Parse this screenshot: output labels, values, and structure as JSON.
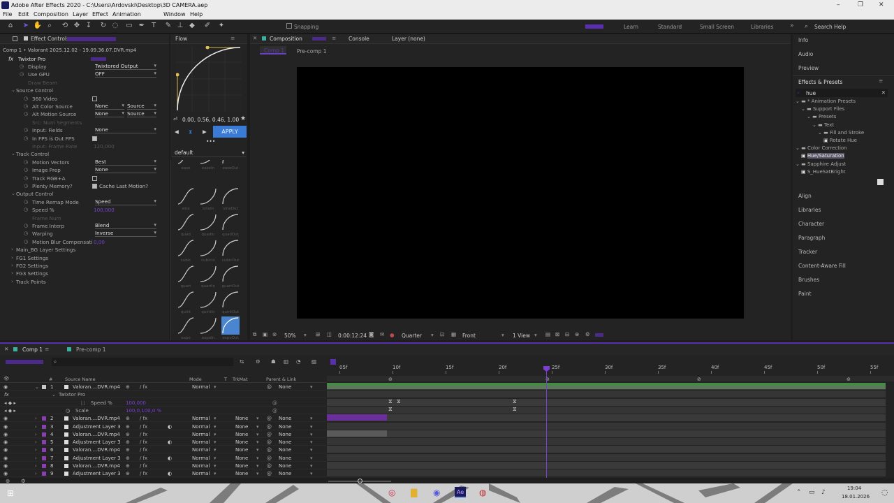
{
  "window": {
    "title": "Adobe After Effects 2020 - C:\\Users\\Ardovski\\Desktop\\3D CAMERA.aep",
    "min": "–",
    "max": "❐",
    "close": "✕"
  },
  "menu": [
    "File",
    "Edit",
    "Composition",
    "Layer",
    "Effect",
    "Animation",
    "Window",
    "Help"
  ],
  "toolbar": {
    "snapping": "Snapping",
    "workspaces": [
      "Learn",
      "Standard",
      "Small Screen",
      "Libraries"
    ],
    "search": "Search Help",
    "more": "»"
  },
  "effect_controls": {
    "tab": "Effect Controls",
    "breadcrumb": "Comp 1 • Valorant 2025.12.02 - 19.09.36.07.DVR.mp4",
    "effect_name": "Twixtor Pro",
    "rows": [
      {
        "label": "Display",
        "value": "Twixtored Output",
        "kind": "dropdown",
        "indent": 2
      },
      {
        "label": "Use GPU",
        "value": "OFF",
        "kind": "dropdown",
        "indent": 2
      },
      {
        "label": "Draw Beam",
        "value": "",
        "kind": "disabled",
        "indent": 2
      },
      {
        "label": "Source Control",
        "value": "",
        "kind": "group",
        "indent": 1
      },
      {
        "label": "360 Video",
        "value": "",
        "kind": "checkbox",
        "indent": 3
      },
      {
        "label": "Alt Color Source",
        "value": "None",
        "value2": "Source",
        "kind": "dual",
        "indent": 3
      },
      {
        "label": "Alt Motion Source",
        "value": "None",
        "value2": "Source",
        "kind": "dual",
        "indent": 3
      },
      {
        "label": "Src: Num Segments",
        "value": "",
        "kind": "disabled",
        "indent": 3
      },
      {
        "label": "Input: Fields",
        "value": "None",
        "kind": "dropdown",
        "indent": 3
      },
      {
        "label": "In FPS is Out FPS",
        "value": "",
        "kind": "checked",
        "indent": 3
      },
      {
        "label": "Input: Frame Rate",
        "value": "120,000",
        "kind": "disabled",
        "indent": 3
      },
      {
        "label": "Track Control",
        "value": "",
        "kind": "group",
        "indent": 1
      },
      {
        "label": "Motion Vectors",
        "value": "Best",
        "kind": "dropdown",
        "indent": 3
      },
      {
        "label": "Image Prep",
        "value": "None",
        "kind": "dropdown",
        "indent": 3
      },
      {
        "label": "Track RGB+A",
        "value": "",
        "kind": "checkbox",
        "indent": 3
      },
      {
        "label": "Plenty Memory?",
        "value": "Cache Last Motion?",
        "kind": "checkedlabel",
        "indent": 3
      },
      {
        "label": "Output Control",
        "value": "",
        "kind": "group",
        "indent": 1
      },
      {
        "label": "Time Remap Mode",
        "value": "Speed",
        "kind": "dropdown",
        "indent": 3
      },
      {
        "label": "Speed %",
        "value": "100,000",
        "kind": "purple",
        "indent": 3
      },
      {
        "label": "Frame Num",
        "value": "",
        "kind": "disabled",
        "indent": 3
      },
      {
        "label": "Frame Interp",
        "value": "Blend",
        "kind": "dropdown",
        "indent": 3
      },
      {
        "label": "Warping",
        "value": "Inverse",
        "kind": "dropdown",
        "indent": 3
      },
      {
        "label": "Motion Blur Compensati",
        "value": "0,00",
        "kind": "purple",
        "indent": 3
      },
      {
        "label": "Main_BG Layer Settings",
        "value": "",
        "kind": "group",
        "indent": 1
      },
      {
        "label": "FG1 Settings",
        "value": "",
        "kind": "group",
        "indent": 1
      },
      {
        "label": "FG2 Settings",
        "value": "",
        "kind": "group",
        "indent": 1
      },
      {
        "label": "FG3 Settings",
        "value": "",
        "kind": "group",
        "indent": 1
      },
      {
        "label": "Track Points",
        "value": "",
        "kind": "group",
        "indent": 1
      }
    ]
  },
  "flow": {
    "tab": "Flow",
    "bezier": "0.00, 0.56, 0.46, 1.00",
    "apply": "APPLY",
    "preset": "default",
    "presets": [
      [
        "ease",
        "easeIn",
        "easeOut"
      ],
      [
        "sine",
        "sineIn",
        "sineOut"
      ],
      [
        "quad",
        "quadIn",
        "quadOut"
      ],
      [
        "cubic",
        "cubicIn",
        "cubicOut"
      ],
      [
        "quart",
        "quartIn",
        "quartOut"
      ],
      [
        "quint",
        "quintIn",
        "quintOut"
      ],
      [
        "expo",
        "expoIn",
        "expoOut"
      ]
    ]
  },
  "composition": {
    "tabs": [
      "Composition",
      "Console",
      "Layer (none)"
    ],
    "comp_name": "Comp 1",
    "subtab": "Pre-comp 1",
    "zoom": "50%",
    "timecode": "0:00:12:24",
    "resolution": "Quarter",
    "view": "Front",
    "views": "1 View"
  },
  "right_panel": {
    "top": [
      "Info",
      "Audio",
      "Preview"
    ],
    "effects_title": "Effects & Presets",
    "search": "hue",
    "tree": [
      {
        "label": "* Animation Presets",
        "indent": 0
      },
      {
        "label": "Support Files",
        "indent": 1
      },
      {
        "label": "Presets",
        "indent": 2
      },
      {
        "label": "Text",
        "indent": 3
      },
      {
        "label": "Fill and Stroke",
        "indent": 4
      },
      {
        "label": "Rotate Hue",
        "indent": 5
      },
      {
        "label": "Color Correction",
        "indent": 0
      },
      {
        "label": "Hue/Saturation",
        "indent": 1
      },
      {
        "label": "Sapphire Adjust",
        "indent": 0
      },
      {
        "label": "S_HueSatBright",
        "indent": 1
      }
    ],
    "bottom": [
      "Align",
      "Libraries",
      "Character",
      "Paragraph",
      "Tracker",
      "Content-Aware Fill",
      "Brushes",
      "Paint"
    ]
  },
  "timeline": {
    "tabs": [
      "Comp 1",
      "Pre-comp 1"
    ],
    "timecode": "0:00:12:24",
    "headers": {
      "source": "Source Name",
      "parent": "Parent & Link",
      "mode": "Mode",
      "t": "T",
      "trkmat": "TrkMat",
      "hash": "#"
    },
    "ruler": [
      "05f",
      "10f",
      "15f",
      "20f",
      "25f",
      "30f",
      "35f",
      "40f",
      "45f",
      "50f",
      "55f"
    ],
    "layers": [
      {
        "num": "1",
        "name": "Valoran....DVR.mp4",
        "mode": "Normal",
        "trkmat": "",
        "parent": "None"
      },
      {
        "num": "",
        "name": "Twixtor Pro",
        "mode": "",
        "trkmat": "",
        "parent": ""
      },
      {
        "num": "",
        "name": "Speed %",
        "mode": "",
        "trkmat": "",
        "parent": ""
      },
      {
        "num": "",
        "name": "Scale",
        "mode": "",
        "trkmat": "",
        "parent": ""
      },
      {
        "num": "2",
        "name": "Valoran....DVR.mp4",
        "mode": "Normal",
        "trkmat": "None",
        "parent": "None"
      },
      {
        "num": "3",
        "name": "Adjustment Layer 3",
        "mode": "Normal",
        "trkmat": "None",
        "parent": "None"
      },
      {
        "num": "4",
        "name": "Valoran....DVR.mp4",
        "mode": "Normal",
        "trkmat": "None",
        "parent": "None"
      },
      {
        "num": "5",
        "name": "Adjustment Layer 3",
        "mode": "Normal",
        "trkmat": "None",
        "parent": "None"
      },
      {
        "num": "6",
        "name": "Valoran....DVR.mp4",
        "mode": "Normal",
        "trkmat": "None",
        "parent": "None"
      },
      {
        "num": "7",
        "name": "Adjustment Layer 3",
        "mode": "Normal",
        "trkmat": "None",
        "parent": "None"
      },
      {
        "num": "8",
        "name": "Valoran....DVR.mp4",
        "mode": "Normal",
        "trkmat": "None",
        "parent": "None"
      },
      {
        "num": "9",
        "name": "Adjustment Layer 3",
        "mode": "Normal",
        "trkmat": "None",
        "parent": "None"
      }
    ],
    "scale_value": "100,0,100,0 %",
    "speed_value": "100,000"
  },
  "taskbar": {
    "time": "19:04",
    "date": "18.01.2026"
  },
  "colors": {
    "accent": "#7b3fd6",
    "apply": "#3a7bd5",
    "selection": "#4a86d0",
    "green_bar": "#3f8f3f"
  }
}
